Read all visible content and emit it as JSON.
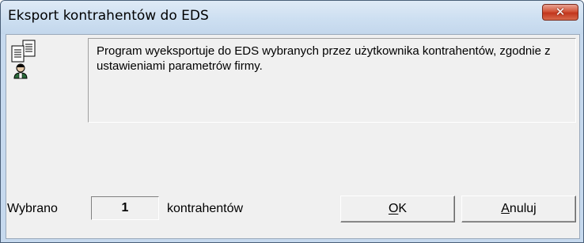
{
  "window": {
    "title": "Eksport kontrahentów do EDS",
    "close_glyph": "✕"
  },
  "icon": "export-contractors-icon",
  "message": "Program wyeksportuje do EDS wybranych przez użytkownika kontrahentów, zgodnie z ustawieniami parametrów firmy.",
  "selection": {
    "label_before": "Wybrano",
    "count": "1",
    "label_after": "kontrahentów"
  },
  "buttons": {
    "ok": "OK",
    "cancel": "Anuluj"
  },
  "colors": {
    "title_bar": "#c6d9ee",
    "close_button": "#c2351c",
    "dialog_bg": "#f0f0f0"
  }
}
